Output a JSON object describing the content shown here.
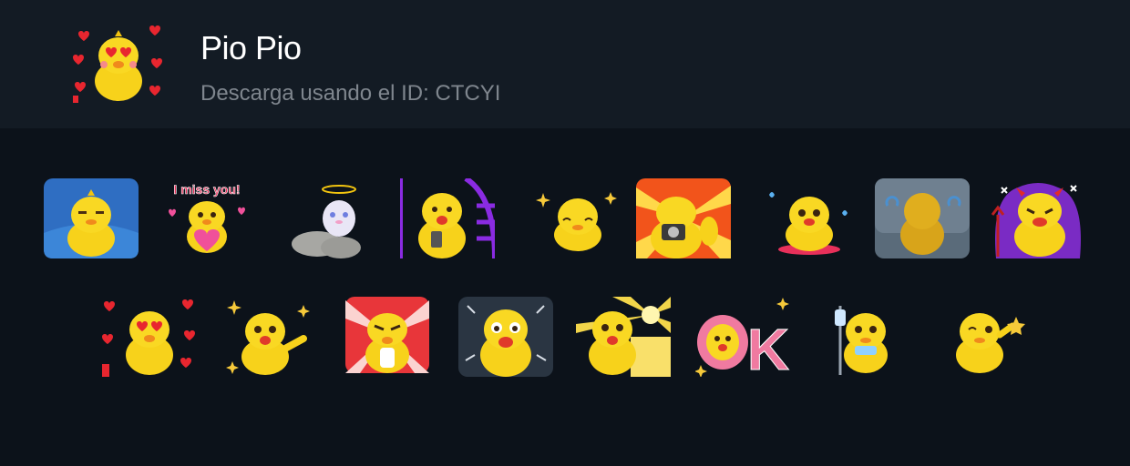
{
  "pack": {
    "title": "Pio Pio",
    "subtitle": "Descarga usando el ID: CTCYI",
    "icon": "duck-hearts-eyes-icon"
  },
  "stickers": [
    {
      "name": "sticker-duck-smug",
      "icon": "duck-smug-blue-icon"
    },
    {
      "name": "sticker-duck-i-miss-you",
      "icon": "duck-heart-icon",
      "text": "I miss you!"
    },
    {
      "name": "sticker-duck-angel",
      "icon": "duck-angel-icon"
    },
    {
      "name": "sticker-duck-phone",
      "icon": "duck-phone-icon"
    },
    {
      "name": "sticker-duck-sparkle",
      "icon": "duck-sparkle-icon"
    },
    {
      "name": "sticker-duck-camera",
      "icon": "duck-camera-icon"
    },
    {
      "name": "sticker-duck-crying",
      "icon": "duck-crying-icon"
    },
    {
      "name": "sticker-duck-back",
      "icon": "duck-back-icon"
    },
    {
      "name": "sticker-duck-devil",
      "icon": "duck-devil-icon"
    },
    {
      "name": "sticker-duck-hearts",
      "icon": "duck-hearts-eyes-icon"
    },
    {
      "name": "sticker-duck-dance",
      "icon": "duck-dance-icon"
    },
    {
      "name": "sticker-duck-angry",
      "icon": "duck-angry-icon"
    },
    {
      "name": "sticker-duck-shocked",
      "icon": "duck-shocked-icon"
    },
    {
      "name": "sticker-duck-idea",
      "icon": "duck-idea-icon"
    },
    {
      "name": "sticker-duck-ok",
      "icon": "duck-ok-icon",
      "text": "OK"
    },
    {
      "name": "sticker-duck-sick",
      "icon": "duck-iv-drip-icon"
    },
    {
      "name": "sticker-duck-wink",
      "icon": "duck-wink-star-icon"
    }
  ]
}
